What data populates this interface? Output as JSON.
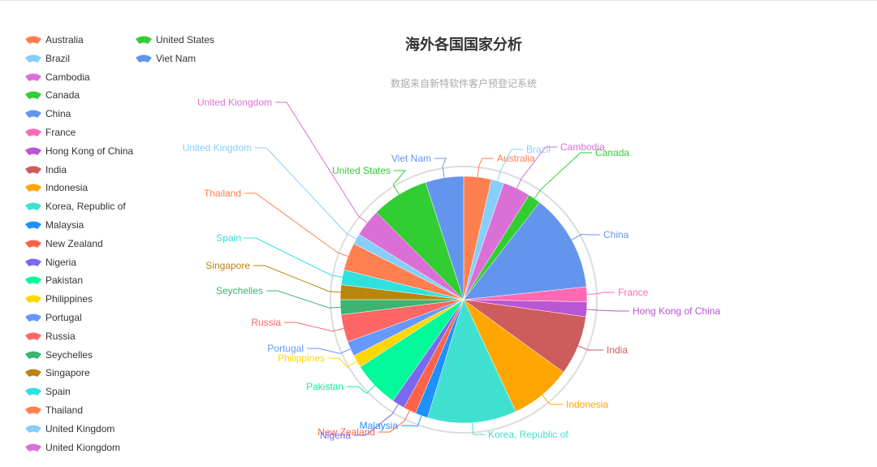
{
  "chart_data": {
    "type": "pie",
    "title": "海外各国国家分析",
    "subtitle": "数据来自新特软件客户预登记系统",
    "legend_position": "top-left",
    "value_note": "values estimated proportionally from slice angles (no numeric labels shown)",
    "series": [
      {
        "name": "Australia",
        "value": 13,
        "color": "#ff7f50"
      },
      {
        "name": "Brazil",
        "value": 6,
        "color": "#87cefa"
      },
      {
        "name": "Cambodia",
        "value": 13,
        "color": "#da70d6"
      },
      {
        "name": "Canada",
        "value": 6,
        "color": "#32cd32"
      },
      {
        "name": "China",
        "value": 46,
        "color": "#6495ed"
      },
      {
        "name": "France",
        "value": 7,
        "color": "#ff69b4"
      },
      {
        "name": "Hong Kong of China",
        "value": 7,
        "color": "#ba55d3"
      },
      {
        "name": "India",
        "value": 28,
        "color": "#cd5c5c"
      },
      {
        "name": "Indonesia",
        "value": 29,
        "color": "#ffa500"
      },
      {
        "name": "Korea, Republic of",
        "value": 42,
        "color": "#40e0d0"
      },
      {
        "name": "Malaysia",
        "value": 6,
        "color": "#1e90ff"
      },
      {
        "name": "New Zealand",
        "value": 6,
        "color": "#ff6347"
      },
      {
        "name": "Nigeria",
        "value": 6,
        "color": "#7b68ee"
      },
      {
        "name": "Pakistan",
        "value": 22,
        "color": "#00fa9a"
      },
      {
        "name": "Philippines",
        "value": 6,
        "color": "#ffd700"
      },
      {
        "name": "Portugal",
        "value": 7,
        "color": "#6699ff"
      },
      {
        "name": "Russia",
        "value": 13,
        "color": "#ff6666"
      },
      {
        "name": "Seychelles",
        "value": 7,
        "color": "#3cb371"
      },
      {
        "name": "Singapore",
        "value": 7,
        "color": "#b8860b"
      },
      {
        "name": "Spain",
        "value": 7,
        "color": "#30e0e0"
      },
      {
        "name": "Thailand",
        "value": 13,
        "color": "#ff7f50"
      },
      {
        "name": "United Kingdom",
        "value": 5,
        "color": "#87cefa"
      },
      {
        "name": "United Kiongdom",
        "value": 13,
        "color": "#da70d6"
      },
      {
        "name": "United States",
        "value": 27,
        "color": "#32cd32"
      },
      {
        "name": "Viet Nam",
        "value": 18,
        "color": "#6495ed"
      }
    ]
  }
}
